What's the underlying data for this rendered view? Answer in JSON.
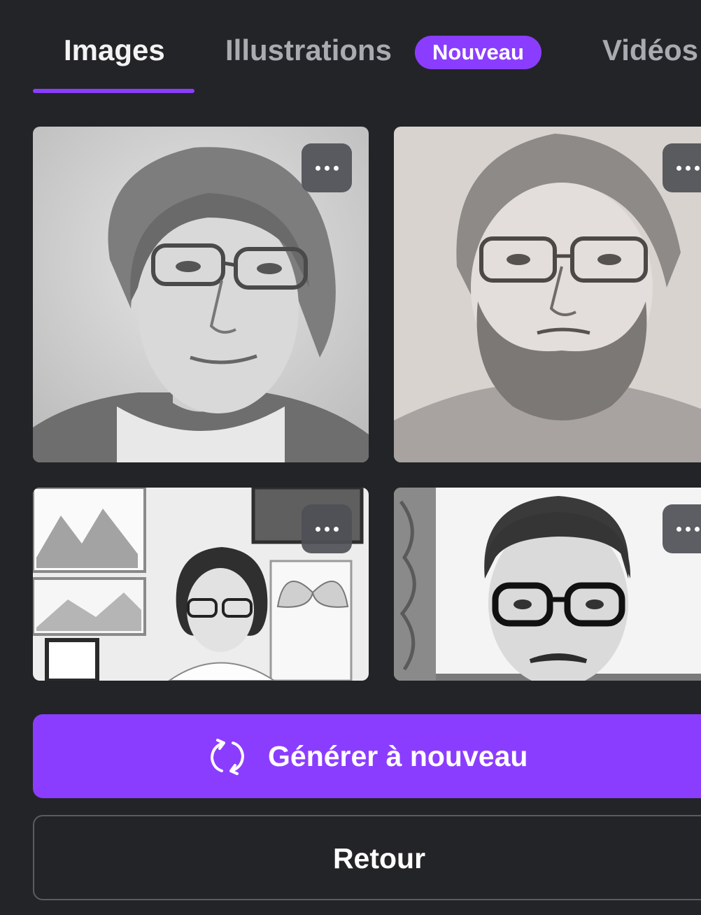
{
  "tabs": [
    {
      "label": "Images",
      "active": true
    },
    {
      "label": "Illustrations",
      "active": false,
      "badge": "Nouveau"
    },
    {
      "label": "Vidéos",
      "active": false
    }
  ],
  "results": [
    {
      "subject": "sketch portrait of person with wavy hair and glasses",
      "menu_icon": "more-horizontal-icon"
    },
    {
      "subject": "sketch portrait of bearded man with glasses",
      "menu_icon": "more-horizontal-icon"
    },
    {
      "subject": "sketch of woman with glasses in studio with framed drawings",
      "menu_icon": "more-horizontal-icon"
    },
    {
      "subject": "sketch portrait of man with glasses and mustache",
      "menu_icon": "more-horizontal-icon"
    }
  ],
  "actions": {
    "regenerate_label": "Générer à nouveau",
    "regenerate_icon": "refresh-icon",
    "back_label": "Retour"
  },
  "colors": {
    "background": "#232427",
    "accent": "#8b3dff",
    "inactive_tab": "#a9abb1",
    "menu_button": "#4e5056"
  }
}
